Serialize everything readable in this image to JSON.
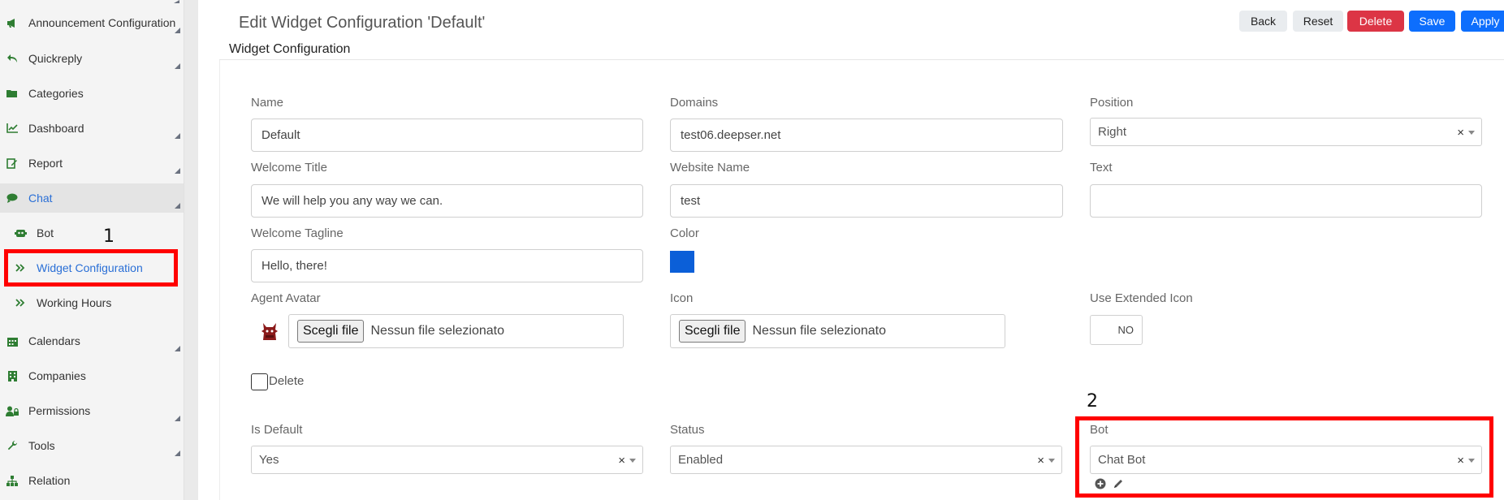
{
  "sidebar": {
    "items": [
      {
        "id": "announcement",
        "label": "Announcement Configuration"
      },
      {
        "id": "quickreply",
        "label": "Quickreply"
      },
      {
        "id": "categories",
        "label": "Categories"
      },
      {
        "id": "dashboard",
        "label": "Dashboard"
      },
      {
        "id": "report",
        "label": "Report"
      },
      {
        "id": "chat",
        "label": "Chat"
      },
      {
        "id": "bot",
        "label": "Bot"
      },
      {
        "id": "widget",
        "label": "Widget Configuration"
      },
      {
        "id": "working",
        "label": "Working Hours"
      },
      {
        "id": "calendars",
        "label": "Calendars"
      },
      {
        "id": "companies",
        "label": "Companies"
      },
      {
        "id": "permissions",
        "label": "Permissions"
      },
      {
        "id": "tools",
        "label": "Tools"
      },
      {
        "id": "relation",
        "label": "Relation"
      }
    ]
  },
  "annotations": {
    "one": "1",
    "two": "2",
    "color": "#ff0000"
  },
  "header": {
    "title": "Edit Widget Configuration 'Default'",
    "section": "Widget Configuration",
    "buttons": {
      "back": "Back",
      "reset": "Reset",
      "delete": "Delete",
      "save": "Save",
      "apply": "Apply"
    }
  },
  "form": {
    "name": {
      "label": "Name",
      "value": "Default"
    },
    "domains": {
      "label": "Domains",
      "value": "test06.deepser.net"
    },
    "position": {
      "label": "Position",
      "value": "Right"
    },
    "welcome_title": {
      "label": "Welcome Title",
      "value": "We will help you any way we can."
    },
    "website_name": {
      "label": "Website Name",
      "value": "test"
    },
    "text": {
      "label": "Text",
      "value": ""
    },
    "welcome_tagline": {
      "label": "Welcome Tagline",
      "value": "Hello, there!"
    },
    "color": {
      "label": "Color",
      "value": "#0b5fd8"
    },
    "agent_avatar": {
      "label": "Agent Avatar",
      "button": "Scegli file",
      "status": "Nessun file selezionato"
    },
    "icon": {
      "label": "Icon",
      "button": "Scegli file",
      "status": "Nessun file selezionato"
    },
    "use_extended_icon": {
      "label": "Use Extended Icon",
      "value": "NO"
    },
    "delete": {
      "label": "Delete"
    },
    "is_default": {
      "label": "Is Default",
      "value": "Yes"
    },
    "status": {
      "label": "Status",
      "value": "Enabled"
    },
    "bot": {
      "label": "Bot",
      "value": "Chat Bot"
    },
    "clear_symbol": "×"
  }
}
